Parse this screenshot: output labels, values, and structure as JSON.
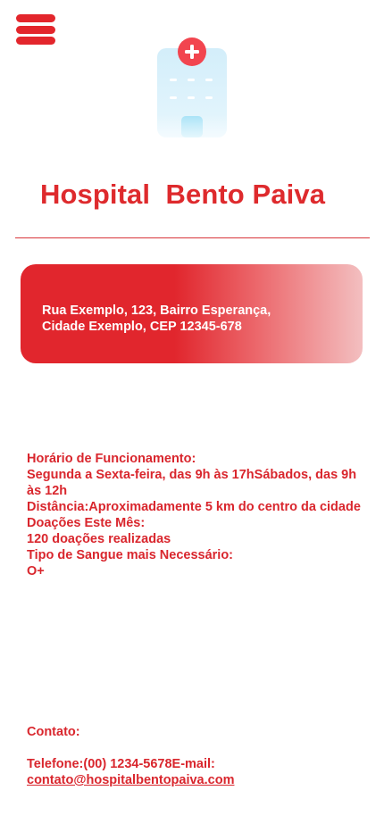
{
  "header": {
    "menu_icon": "hamburger-menu-icon",
    "logo_icon": "hospital-building-icon",
    "title": "Hospital  Bento Paiva"
  },
  "colors": {
    "primary": "#e3262c",
    "card_gradient_start": "#e1262d",
    "card_gradient_end": "#f3bfc0",
    "icon_light_blue": "#d7f0fb"
  },
  "address": {
    "line1": "Rua Exemplo, 123, Bairro Esperança,",
    "line2": "Cidade Exemplo, CEP 12345-678"
  },
  "info": {
    "hours_label": "Horário de Funcionamento:",
    "hours_value": "Segunda a Sexta-feira, das 9h às 17hSábados, das 9h às 12h",
    "distance": "Distância:Aproximadamente 5 km do centro da cidade",
    "donations_label": "Doações Este Mês:",
    "donations_value": "120 doações realizadas",
    "blood_type_label": "Tipo de Sangue mais Necessário:",
    "blood_type_value": "O+"
  },
  "contact": {
    "label": "Contato:",
    "phone_email": "Telefone:(00) 1234-5678E-mail:",
    "email": "contato@hospitalbentopaiva.com"
  }
}
